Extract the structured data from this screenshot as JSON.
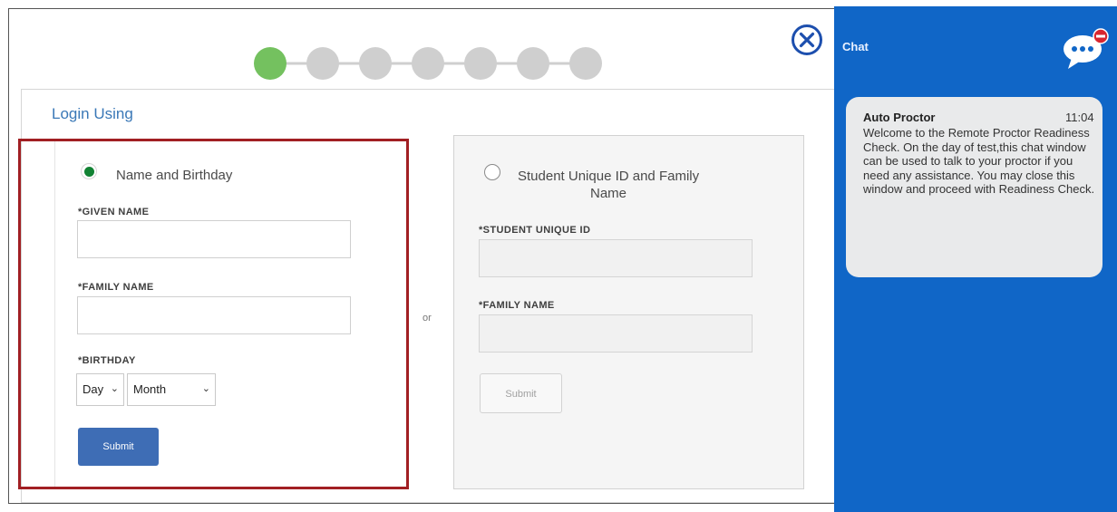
{
  "wizard": {
    "steps_total": 7,
    "current_step": 1,
    "colors": {
      "active": "#74c15f",
      "inactive": "#cfcfcf"
    }
  },
  "login": {
    "title": "Login Using",
    "separator": "or",
    "option_name_birthday": {
      "label": "Name and Birthday",
      "selected": true,
      "given_name_label": "*GIVEN NAME",
      "given_name_value": "",
      "family_name_label": "*FAMILY NAME",
      "family_name_value": "",
      "birthday_label": "*BIRTHDAY",
      "day_selected": "Day",
      "month_selected": "Month",
      "submit_label": "Submit"
    },
    "option_student_id": {
      "label_line1": "Student Unique ID and Family",
      "label_line2": "Name",
      "selected": false,
      "student_id_label": "*STUDENT UNIQUE ID",
      "student_id_value": "",
      "family_name_label": "*FAMILY NAME",
      "family_name_value": "",
      "submit_label": "Submit"
    }
  },
  "chat": {
    "title": "Chat",
    "messages": [
      {
        "sender": "Auto Proctor",
        "time": "11:04",
        "text": "Welcome to the Remote Proctor Readiness Check. On the day of test,this chat window can be used to talk to your proctor if you need any assistance. You may close this window and proceed with Readiness Check."
      }
    ]
  },
  "colors": {
    "chat_bg": "#1066c7",
    "selected_box_border": "#a11f23",
    "primary_button": "#3e6db5",
    "link_blue": "#3a78b7",
    "radio_selected": "#118233"
  },
  "icons": {
    "close": "close-circle-icon",
    "chat": "chat-bubble-icon",
    "dropdown": "chevron-down-icon"
  }
}
